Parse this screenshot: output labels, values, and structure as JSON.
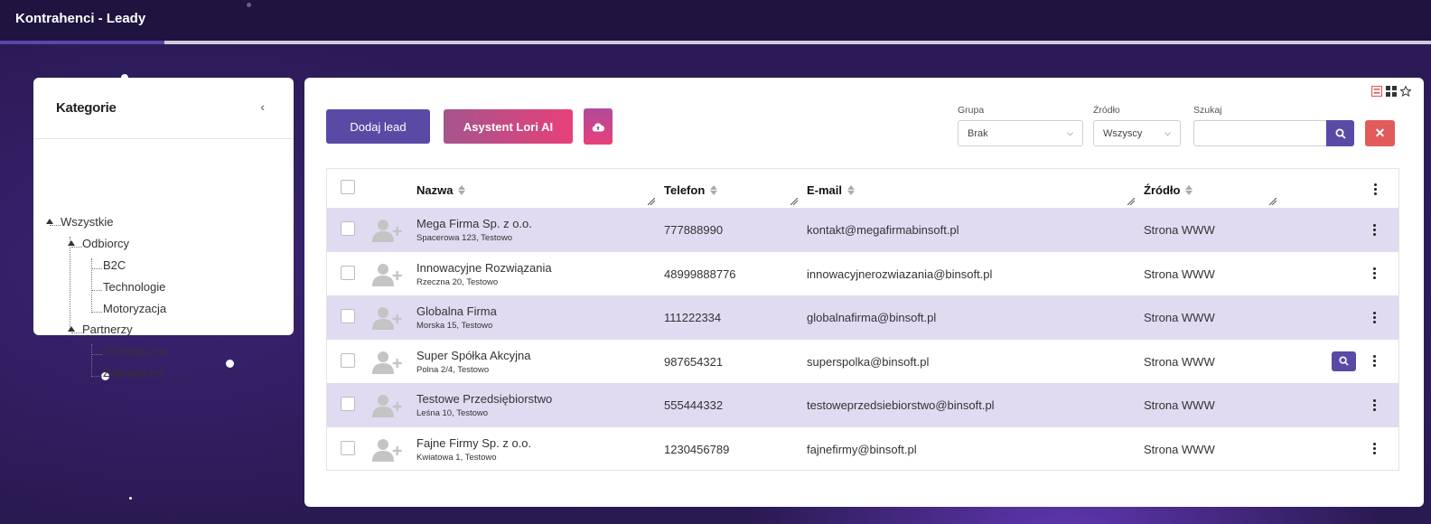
{
  "app": {
    "title": "Kontrahenci - Leady",
    "load_progress": 0.115
  },
  "categories": {
    "title": "Kategorie",
    "collapse_glyph": "‹",
    "tree": [
      {
        "label": "Wszystkie",
        "level": 0
      },
      {
        "label": "Odbiorcy",
        "level": 1
      },
      {
        "label": "B2C",
        "level": 2
      },
      {
        "label": "Technologie",
        "level": 2
      },
      {
        "label": "Motoryzacja",
        "level": 2
      },
      {
        "label": "Partnerzy",
        "level": 1
      },
      {
        "label": "Strategiczny",
        "level": 2
      },
      {
        "label": "Zagraniczni",
        "level": 2
      }
    ]
  },
  "toolbar": {
    "add_label": "Dodaj lead",
    "ai_label": "Asystent Lori AI",
    "upload_icon": "cloud-upload-icon",
    "view_icons": [
      "list-view-icon",
      "grid-view-icon",
      "star-icon"
    ]
  },
  "filters": {
    "group_label": "Grupa",
    "group_value": "Brak",
    "source_label": "Źródło",
    "source_value": "Wszyscy",
    "search_label": "Szukaj",
    "search_value": "",
    "clear_glyph": "✕"
  },
  "table": {
    "columns": [
      "Nazwa",
      "Telefon",
      "E-mail",
      "Źródło"
    ],
    "rows": [
      {
        "name": "Mega Firma Sp. z o.o.",
        "address": "Spacerowa 123, Testowo",
        "phone": "777888990",
        "email": "kontakt@megafirmabinsoft.pl",
        "source": "Strona WWW"
      },
      {
        "name": "Innowacyjne Rozwiązania",
        "address": "Rzeczna 20, Testowo",
        "phone": "48999888776",
        "email": "innowacyjnerozwiazania@binsoft.pl",
        "source": "Strona WWW"
      },
      {
        "name": "Globalna Firma",
        "address": "Morska 15, Testowo",
        "phone": "111222334",
        "email": "globalnafirma@binsoft.pl",
        "source": "Strona WWW"
      },
      {
        "name": "Super Spółka Akcyjna",
        "address": "Polna 2/4, Testowo",
        "phone": "987654321",
        "email": "superspolka@binsoft.pl",
        "source": "Strona WWW"
      },
      {
        "name": "Testowe Przedsiębiorstwo",
        "address": "Leśna 10, Testowo",
        "phone": "555444332",
        "email": "testoweprzedsiebiorstwo@binsoft.pl",
        "source": "Strona WWW"
      },
      {
        "name": "Fajne Firmy Sp. z o.o.",
        "address": "Kwiatowa 1, Testowo",
        "phone": "1230456789",
        "email": "fajnefirmy@binsoft.pl",
        "source": "Strona WWW"
      }
    ]
  },
  "colors": {
    "accent": "#5b4aa5",
    "danger": "#e25b5b",
    "row_highlight": "#e1dbf2"
  }
}
